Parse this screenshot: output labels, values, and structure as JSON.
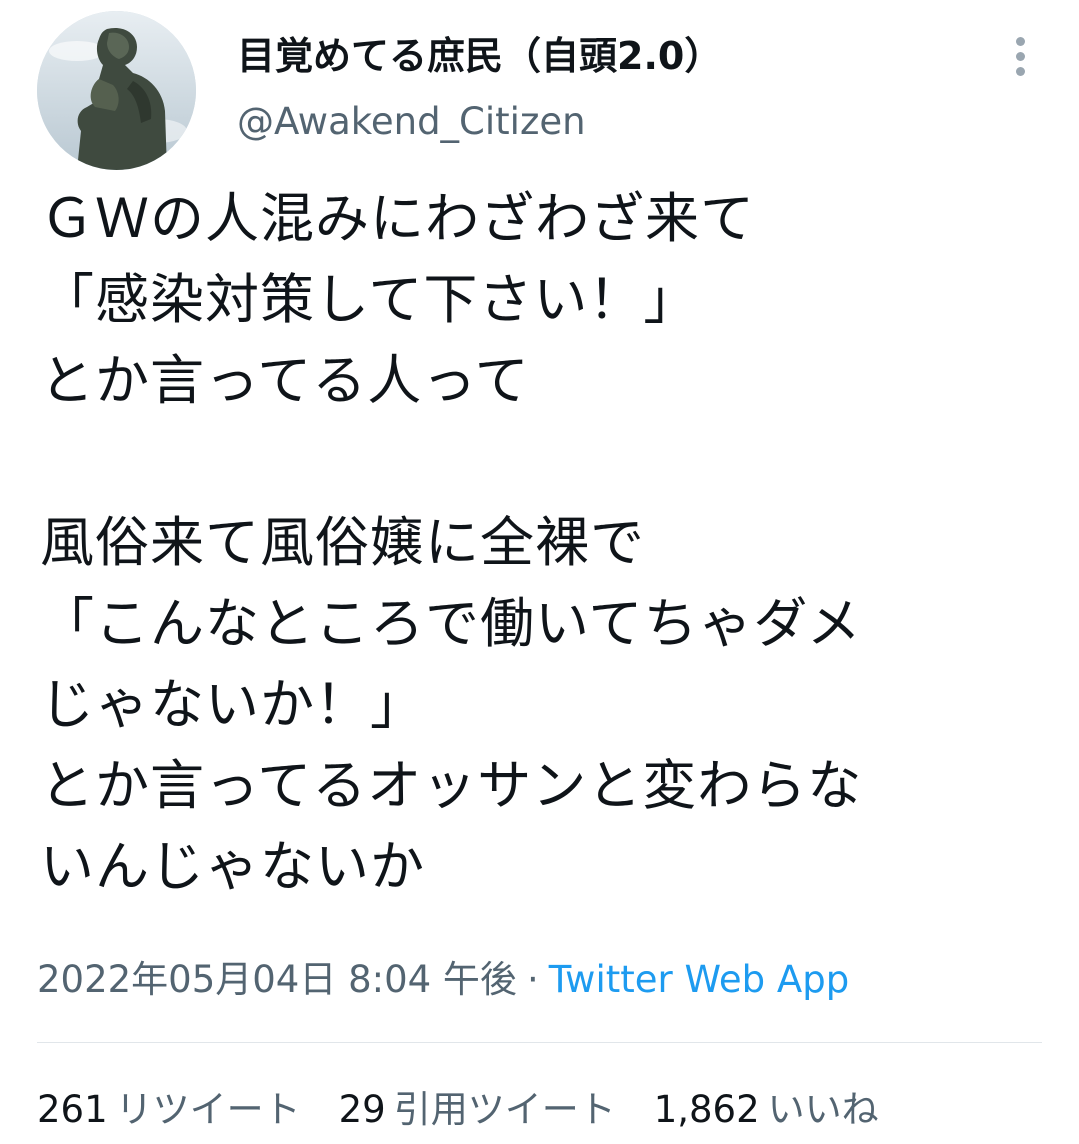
{
  "author": {
    "display_name": "目覚めてる庶民（自頭2.0）",
    "handle": "@Awakend_Citizen",
    "avatar_icon": "thinker-statue-avatar"
  },
  "tweet": {
    "lines": [
      "ＧＷの人混みにわざわざ来て",
      "「感染対策して下さい！」",
      "とか言ってる人って",
      "",
      "風俗来て風俗嬢に全裸で",
      "「こんなところで働いてちゃダメ",
      "じゃないか！」",
      "とか言ってるオッサンと変わらな",
      "いんじゃないか"
    ]
  },
  "meta": {
    "timestamp": "2022年05月04日 8:04 午後",
    "separator": "·",
    "source": "Twitter Web App"
  },
  "stats": {
    "retweets_count": "261",
    "retweets_label": "リツイート",
    "quotes_count": "29",
    "quotes_label": "引用ツイート",
    "likes_count": "1,862",
    "likes_label": "いいね"
  },
  "colors": {
    "text_primary": "#0f1419",
    "text_secondary": "#536471",
    "link": "#1d9bf0",
    "divider": "#e1e6ea"
  }
}
